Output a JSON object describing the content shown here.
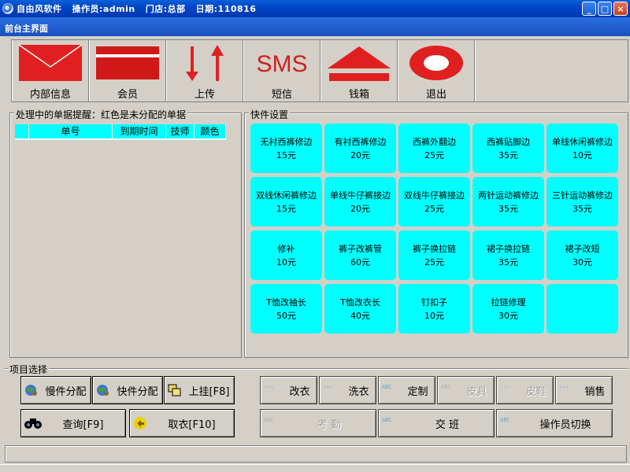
{
  "window": {
    "title": "自由风软件   操作员:admin   门店:总部   日期:110816",
    "subtitle": "前台主界面",
    "controls": {
      "minimize": "_",
      "maximize": "□",
      "close": "×"
    }
  },
  "toolbar": {
    "items": [
      {
        "label": "内部信息",
        "icon": "envelope-icon"
      },
      {
        "label": "会员",
        "icon": "card-icon"
      },
      {
        "label": "上传",
        "icon": "up-down-arrows-icon"
      },
      {
        "label": "短信",
        "icon": "sms-icon",
        "icon_text": "SMS"
      },
      {
        "label": "钱箱",
        "icon": "eject-icon"
      },
      {
        "label": "退出",
        "icon": "exit-ring-icon"
      }
    ]
  },
  "pending": {
    "title": "处理中的单据提醒：红色是未分配的单据",
    "columns": [
      "单号",
      "到期时间",
      "技师",
      "颜色"
    ]
  },
  "express": {
    "title": "快件设置",
    "tiles": [
      {
        "name": "无衬西裤修边",
        "price": "15元"
      },
      {
        "name": "有衬西裤修边",
        "price": "20元"
      },
      {
        "name": "西裤外翻边",
        "price": "25元"
      },
      {
        "name": "西裤贴脚边",
        "price": "35元"
      },
      {
        "name": "单线休闲裤修边",
        "price": "10元"
      },
      {
        "name": "双线休闲裤修边",
        "price": "15元"
      },
      {
        "name": "单线牛仔裤接边",
        "price": "20元"
      },
      {
        "name": "双线牛仔裤接边",
        "price": "25元"
      },
      {
        "name": "两针运动裤修边",
        "price": "35元"
      },
      {
        "name": "三针运动裤修边",
        "price": "35元"
      },
      {
        "name": "修补",
        "price": "10元"
      },
      {
        "name": "裤子改裤管",
        "price": "60元"
      },
      {
        "name": "裤子换拉链",
        "price": "25元"
      },
      {
        "name": "裙子换拉链",
        "price": "35元"
      },
      {
        "name": "裙子改短",
        "price": "30元"
      },
      {
        "name": "T恤改袖长",
        "price": "50元"
      },
      {
        "name": "T恤改衣长",
        "price": "40元"
      },
      {
        "name": "钉扣子",
        "price": "10元"
      },
      {
        "name": "拉链修理",
        "price": "30元"
      }
    ]
  },
  "project": {
    "title": "项目选择",
    "left_buttons": {
      "slow_assign": "慢件分配",
      "fast_assign": "快件分配",
      "hang": "上挂[F8]",
      "query": "查询[F9]",
      "pickup": "取衣[F10]"
    },
    "right_buttons": {
      "alter": "改衣",
      "wash": "洗衣",
      "custom": "定制",
      "leather": "皮具",
      "shoes": "皮鞋",
      "sales": "销售",
      "attendance": "考    勤",
      "handover": "交        班",
      "switch_operator": "操作员切换"
    },
    "arrow_glyph": "›››",
    "abc_glyph": "ABC"
  },
  "colors": {
    "tile": "#00ffff",
    "title_bar": "#0046c8",
    "toolbar_red": "#e02020",
    "background": "#d4d0c8"
  }
}
